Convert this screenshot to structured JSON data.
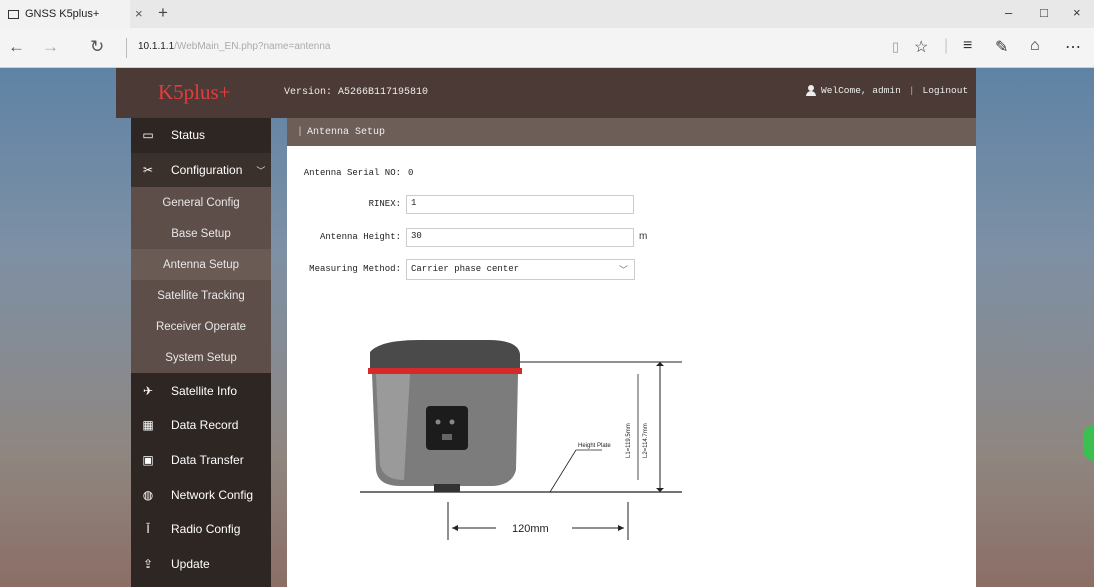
{
  "browser": {
    "tab_title": "GNSS K5plus+",
    "tab_close": "×",
    "new_tab": "+",
    "window_controls": [
      "–",
      "□",
      "×"
    ],
    "nav": {
      "back": "←",
      "forward": "→",
      "refresh": "↻"
    },
    "url_main": "10.1.1.1",
    "url_rest": "/WebMain_EN.php?name=antenna",
    "toolbar_icons": [
      "reading-view-icon",
      "favorite-star-icon",
      "hub-icon",
      "web-note-icon",
      "share-icon",
      "more-icon"
    ]
  },
  "header": {
    "logo": "K5plus+",
    "version": "Version: A5266B117195810",
    "welcome": "WelCome, admin",
    "separator": "|",
    "logout": "Loginout"
  },
  "sidebar": {
    "items": [
      {
        "label": "Status",
        "icon": "monitor-icon"
      },
      {
        "label": "Configuration",
        "icon": "tools-icon",
        "expanded": true
      },
      {
        "label": "Satellite Info",
        "icon": "satellite-icon"
      },
      {
        "label": "Data Record",
        "icon": "calendar-icon"
      },
      {
        "label": "Data Transfer",
        "icon": "transfer-icon"
      },
      {
        "label": "Network Config",
        "icon": "globe-icon"
      },
      {
        "label": "Radio Config",
        "icon": "antenna-icon"
      },
      {
        "label": "Update",
        "icon": "upload-icon"
      }
    ],
    "sub_items": [
      "General Config",
      "Base Setup",
      "Antenna Setup",
      "Satellite Tracking",
      "Receiver Operate",
      "System Setup"
    ]
  },
  "breadcrumb": "Antenna Setup",
  "form": {
    "serial_label": "Antenna Serial NO:",
    "serial_value": "0",
    "rinex_label": "RINEX:",
    "rinex_value": "1",
    "height_label": "Antenna Height:",
    "height_value": "30",
    "height_unit": "m",
    "method_label": "Measuring Method:",
    "method_value": "Carrier phase center"
  },
  "diagram": {
    "height_plate": "Height Plate",
    "l1": "L1=119.5mm",
    "l2": "L2=114.7mm",
    "width": "120mm"
  }
}
